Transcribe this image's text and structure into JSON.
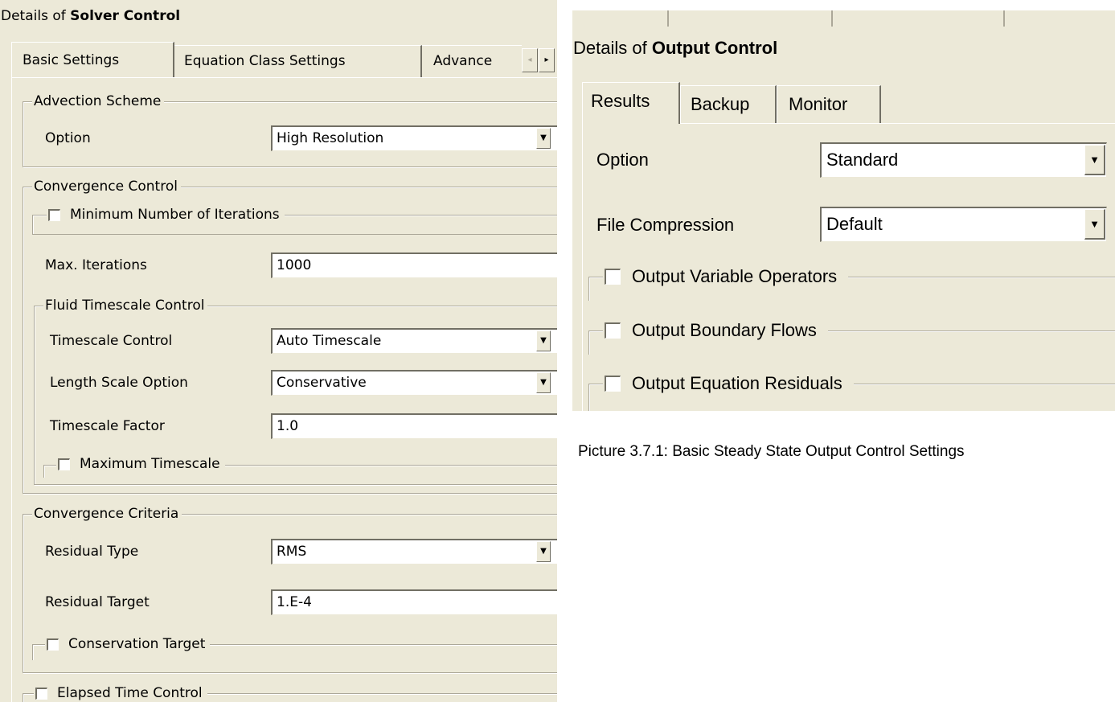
{
  "solver_panel": {
    "title_prefix": "Details of ",
    "title_object": "Solver Control",
    "tabs": [
      {
        "label": "Basic Settings"
      },
      {
        "label": "Equation Class Settings"
      },
      {
        "label": "Advance"
      }
    ],
    "tab_scroll_left_icon": "◂",
    "tab_scroll_right_icon": "▸",
    "advection_scheme": {
      "title": "Advection Scheme",
      "option_label": "Option",
      "option_value": "High Resolution"
    },
    "convergence_control": {
      "title": "Convergence Control",
      "min_iterations_label": "Minimum Number of Iterations",
      "max_iterations_label": "Max. Iterations",
      "max_iterations_value": "1000",
      "fluid_timescale": {
        "title": "Fluid Timescale Control",
        "timescale_control_label": "Timescale Control",
        "timescale_control_value": "Auto Timescale",
        "length_scale_label": "Length Scale Option",
        "length_scale_value": "Conservative",
        "timescale_factor_label": "Timescale Factor",
        "timescale_factor_value": "1.0",
        "maximum_timescale_label": "Maximum Timescale"
      }
    },
    "convergence_criteria": {
      "title": "Convergence Criteria",
      "residual_type_label": "Residual Type",
      "residual_type_value": "RMS",
      "residual_target_label": "Residual Target",
      "residual_target_value": "1.E-4",
      "conservation_target_label": "Conservation Target"
    },
    "elapsed_time_label": "Elapsed Time Control"
  },
  "output_panel": {
    "title_prefix": "Details of ",
    "title_object": "Output Control",
    "tabs": [
      {
        "label": "Results"
      },
      {
        "label": "Backup"
      },
      {
        "label": "Monitor"
      }
    ],
    "option_label": "Option",
    "option_value": "Standard",
    "file_compression_label": "File Compression",
    "file_compression_value": "Default",
    "output_variable_operators_label": "Output Variable Operators",
    "output_boundary_flows_label": "Output Boundary Flows",
    "output_equation_residuals_label": "Output Equation Residuals"
  },
  "dropdown_icon": "▼",
  "caption": "Picture 3.7.1: Basic Steady State Output Control Settings",
  "colors": {
    "panel_bg": "#ece9d8",
    "border_dark": "#716f64",
    "border_mid": "#aca899"
  }
}
